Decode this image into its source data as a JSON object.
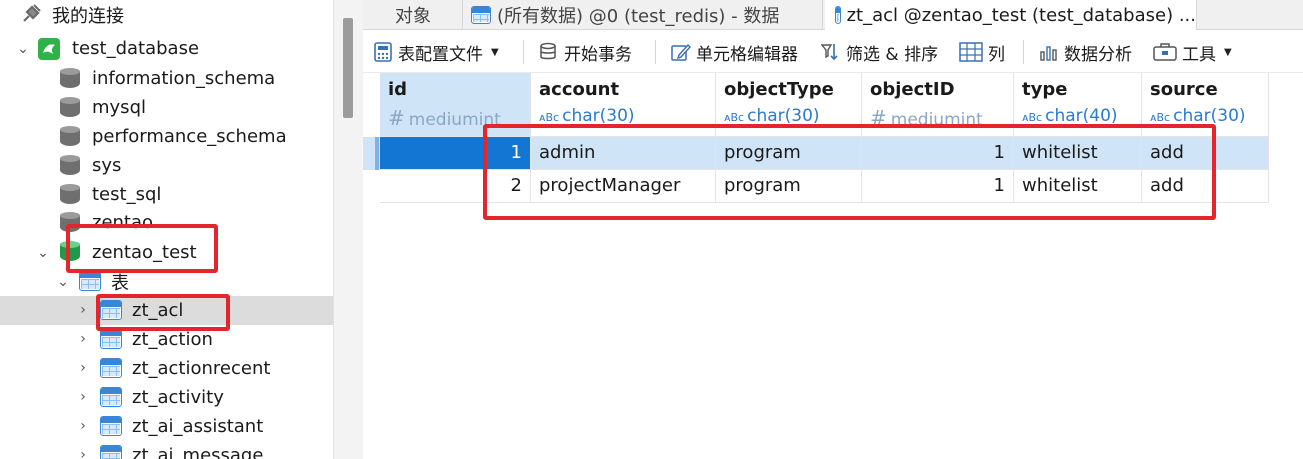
{
  "sidebar": {
    "connections_label": "我的连接",
    "items": [
      {
        "label": "test_database",
        "kind": "connection"
      },
      {
        "label": "information_schema",
        "kind": "db"
      },
      {
        "label": "mysql",
        "kind": "db"
      },
      {
        "label": "performance_schema",
        "kind": "db"
      },
      {
        "label": "sys",
        "kind": "db"
      },
      {
        "label": "test_sql",
        "kind": "db"
      },
      {
        "label": "zentao",
        "kind": "db"
      },
      {
        "label": "zentao_test",
        "kind": "db-open"
      },
      {
        "label": "表",
        "kind": "folder"
      },
      {
        "label": "zt_acl",
        "kind": "table"
      },
      {
        "label": "zt_action",
        "kind": "table"
      },
      {
        "label": "zt_actionrecent",
        "kind": "table"
      },
      {
        "label": "zt_activity",
        "kind": "table"
      },
      {
        "label": "zt_ai_assistant",
        "kind": "table"
      },
      {
        "label": "zt_ai_message",
        "kind": "table"
      }
    ]
  },
  "tabs": [
    {
      "label": "对象"
    },
    {
      "label": "(所有数据) @0 (test_redis) - 数据"
    },
    {
      "label": "zt_acl @zentao_test (test_database) ..."
    }
  ],
  "toolbar": {
    "table_config": "表配置文件",
    "begin_transaction": "开始事务",
    "cell_editor": "单元格编辑器",
    "filter_sort": "筛选 & 排序",
    "columns": "列",
    "data_analysis": "数据分析",
    "tools": "工具"
  },
  "grid": {
    "columns": [
      {
        "name": "id",
        "type": "mediumint",
        "type_kind": "number"
      },
      {
        "name": "account",
        "type": "char(30)",
        "type_kind": "string"
      },
      {
        "name": "objectType",
        "type": "char(30)",
        "type_kind": "string"
      },
      {
        "name": "objectID",
        "type": "mediumint",
        "type_kind": "number"
      },
      {
        "name": "type",
        "type": "char(40)",
        "type_kind": "string"
      },
      {
        "name": "source",
        "type": "char(30)",
        "type_kind": "string"
      }
    ],
    "rows": [
      [
        "1",
        "admin",
        "program",
        "1",
        "whitelist",
        "add"
      ],
      [
        "2",
        "projectManager",
        "program",
        "1",
        "whitelist",
        "add"
      ]
    ],
    "type_prefix_string": "ᴀBc",
    "type_prefix_number": "#"
  },
  "colors": {
    "selection": "#cfe4f7",
    "current_cell": "#1476d3",
    "annotation": "#e4252b",
    "type_text": "#2b7bcf"
  }
}
